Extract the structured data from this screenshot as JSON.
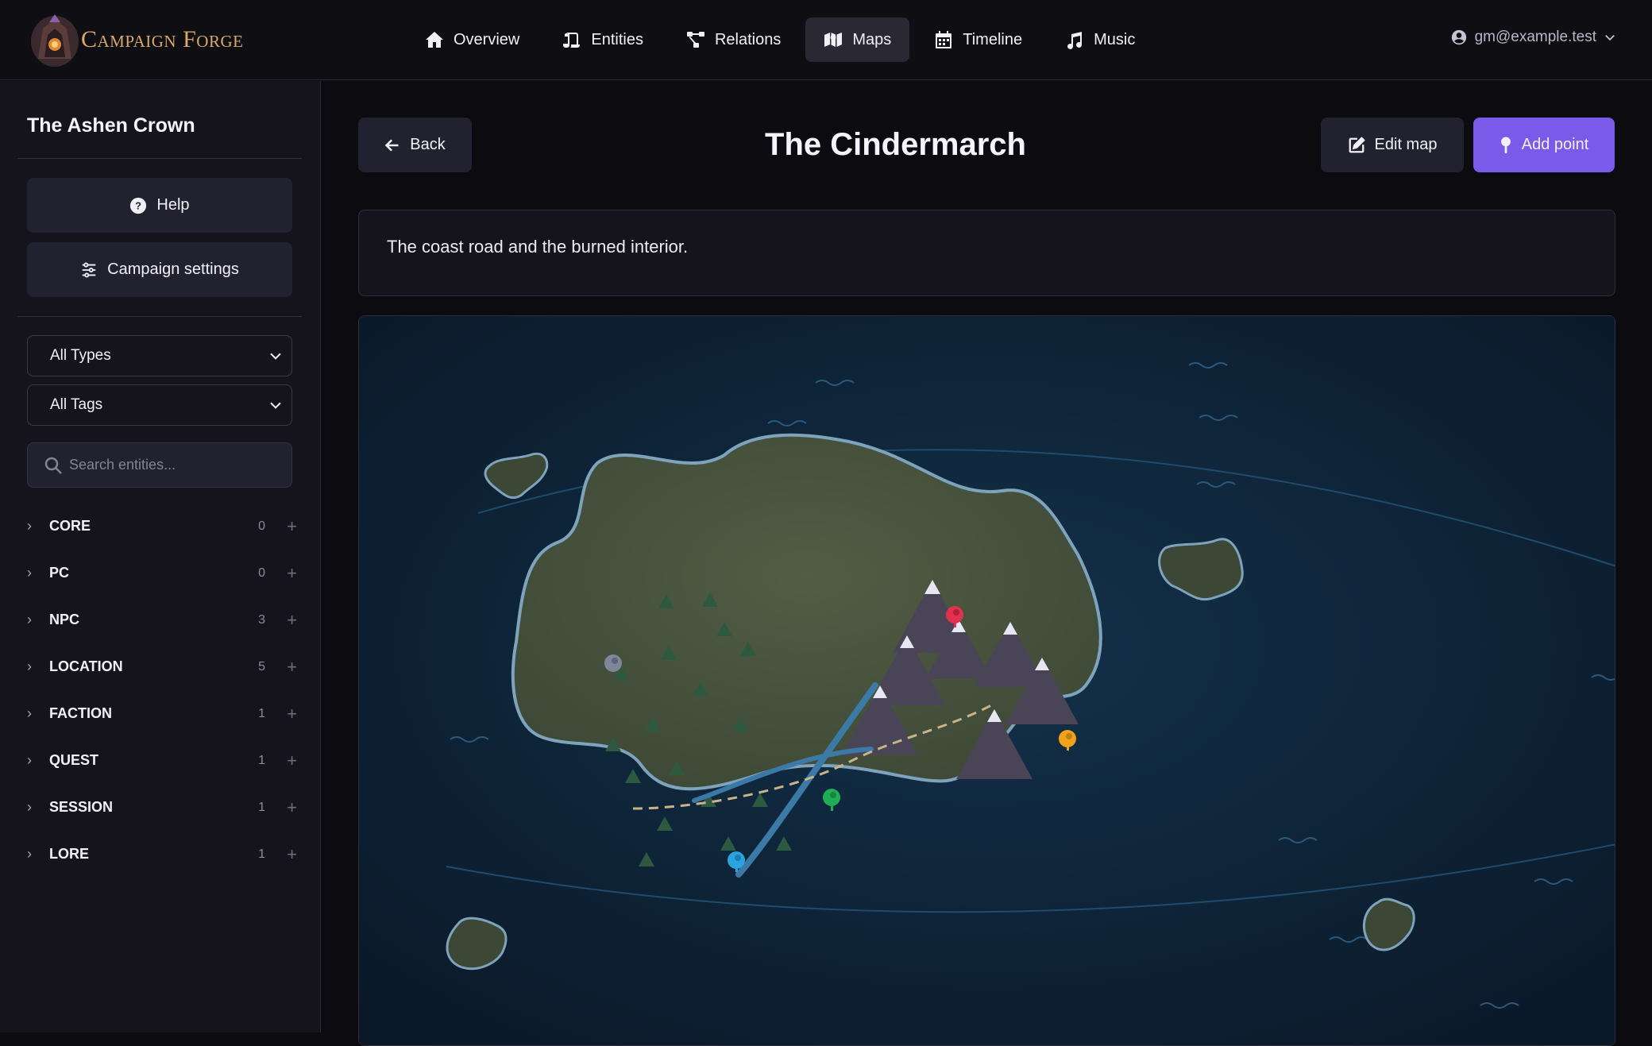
{
  "app": {
    "name": "Campaign Forge"
  },
  "nav": {
    "items": [
      {
        "label": "Overview",
        "icon": "home-icon",
        "active": false
      },
      {
        "label": "Entities",
        "icon": "scroll-icon",
        "active": false
      },
      {
        "label": "Relations",
        "icon": "network-icon",
        "active": false
      },
      {
        "label": "Maps",
        "icon": "map-icon",
        "active": true
      },
      {
        "label": "Timeline",
        "icon": "calendar-icon",
        "active": false
      },
      {
        "label": "Music",
        "icon": "music-icon",
        "active": false
      }
    ],
    "user_email": "gm@example.test"
  },
  "sidebar": {
    "campaign_title": "The Ashen Crown",
    "help_label": "Help",
    "settings_label": "Campaign settings",
    "type_filter": "All Types",
    "tag_filter": "All Tags",
    "search_placeholder": "Search entities...",
    "categories": [
      {
        "label": "CORE",
        "count": "0"
      },
      {
        "label": "PC",
        "count": "0"
      },
      {
        "label": "NPC",
        "count": "3"
      },
      {
        "label": "LOCATION",
        "count": "5"
      },
      {
        "label": "FACTION",
        "count": "1"
      },
      {
        "label": "QUEST",
        "count": "1"
      },
      {
        "label": "SESSION",
        "count": "1"
      },
      {
        "label": "LORE",
        "count": "1"
      }
    ]
  },
  "main": {
    "back_label": "Back",
    "title": "The Cindermarch",
    "edit_label": "Edit map",
    "add_point_label": "Add point",
    "description": "The coast road and the burned interior."
  },
  "map": {
    "pins": [
      {
        "name": "map-pin-gray",
        "color": "#7d8799"
      },
      {
        "name": "map-pin-red",
        "color": "#e0314f"
      },
      {
        "name": "map-pin-orange",
        "color": "#f0a21a"
      },
      {
        "name": "map-pin-green",
        "color": "#1fae54"
      },
      {
        "name": "map-pin-blue",
        "color": "#2aa3e0"
      }
    ]
  },
  "colors": {
    "accent": "#7a5ae8",
    "background": "#0c0b10",
    "sidebar": "#15141c",
    "land": "#4a5540",
    "water": "#0f2236"
  }
}
